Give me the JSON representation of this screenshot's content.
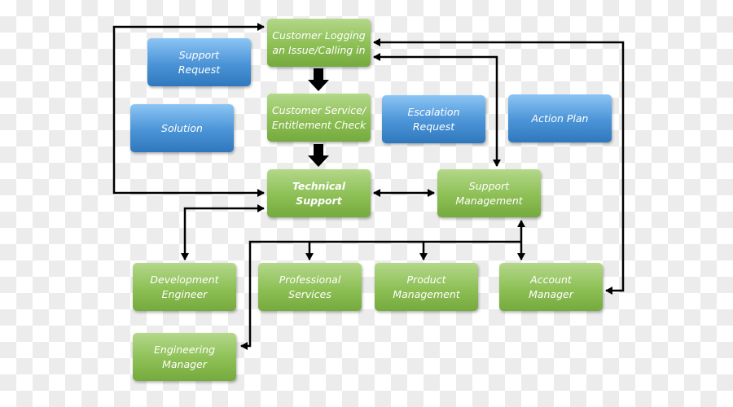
{
  "nodes": {
    "customer_logging": "Customer Logging\nan Issue/Calling in",
    "support_request": "Support\nRequest",
    "customer_service": "Customer Service/\nEntitlement Check",
    "solution": "Solution",
    "escalation_request": "Escalation\nRequest",
    "action_plan": "Action Plan",
    "technical_support": "Technical\nSupport",
    "support_management": "Support\nManagement",
    "development_engineer": "Development\nEngineer",
    "professional_services": "Professional\nServices",
    "product_management": "Product\nManagement",
    "account_manager": "Account\nManager",
    "engineering_manager": "Engineering\nManager"
  },
  "colors": {
    "process": "#8dbf55",
    "output": "#4a93d6",
    "connector": "#000000"
  }
}
